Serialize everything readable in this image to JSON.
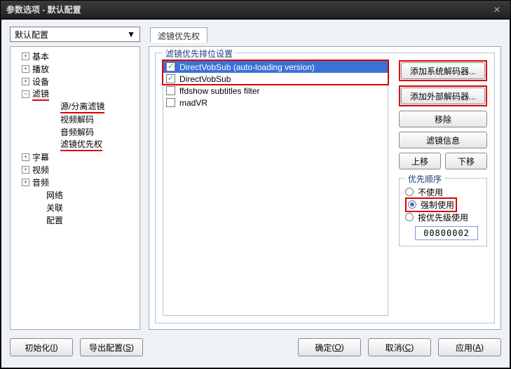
{
  "window": {
    "title": "参数选项 - 默认配置"
  },
  "combo": {
    "value": "默认配置"
  },
  "tabs": {
    "active": "滤镜优先权"
  },
  "tree": {
    "items": [
      {
        "label": "基本",
        "exp": "▸",
        "indent": 1
      },
      {
        "label": "播放",
        "exp": "▸",
        "indent": 1
      },
      {
        "label": "设备",
        "exp": "▸",
        "indent": 1
      },
      {
        "label": "滤镜",
        "exp": "▾",
        "indent": 1,
        "underline": true
      },
      {
        "label": "源/分离滤镜",
        "indent": 3,
        "underline": true
      },
      {
        "label": "视频解码",
        "indent": 3
      },
      {
        "label": "音频解码",
        "indent": 3
      },
      {
        "label": "滤镜优先权",
        "indent": 3,
        "underline": true
      },
      {
        "label": "字幕",
        "exp": "▸",
        "indent": 1
      },
      {
        "label": "视频",
        "exp": "▸",
        "indent": 1
      },
      {
        "label": "音频",
        "exp": "▸",
        "indent": 1
      },
      {
        "label": "网络",
        "indent": 2
      },
      {
        "label": "关联",
        "indent": 2
      },
      {
        "label": "配置",
        "indent": 2
      }
    ]
  },
  "group": {
    "title": "滤镜优先排位设置"
  },
  "list": {
    "rows": [
      {
        "label": "DirectVobSub (auto-loading version)",
        "checked": true,
        "selected": true
      },
      {
        "label": "DirectVobSub",
        "checked": true,
        "selected": false
      },
      {
        "label": "ffdshow subtitles filter",
        "checked": false,
        "selected": false
      },
      {
        "label": "madVR",
        "checked": false,
        "selected": false
      }
    ]
  },
  "side": {
    "add_sys": "添加系统解码器...",
    "add_ext": "添加外部解码器...",
    "remove": "移除",
    "info": "滤镜信息",
    "up": "上移",
    "down": "下移"
  },
  "priority": {
    "title": "优先顺序",
    "opt_none": "不使用",
    "opt_force": "强制使用",
    "opt_bypri": "按优先级使用",
    "selected": "force",
    "value": "00800002"
  },
  "bottom": {
    "init": "初始化",
    "init_key": "I",
    "export": "导出配置",
    "export_key": "S",
    "ok": "确定",
    "ok_key": "O",
    "cancel": "取消",
    "cancel_key": "C",
    "apply": "应用",
    "apply_key": "A"
  }
}
